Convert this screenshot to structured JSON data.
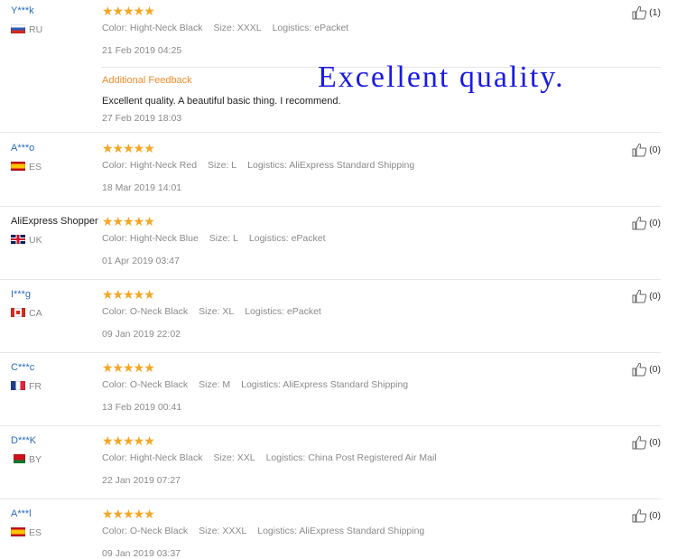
{
  "overlay_caption": "Excellent quality.",
  "reviews": [
    {
      "user": "Y***k",
      "country": "RU",
      "flag": "flag-ru",
      "stars": "★★★★★",
      "color": "Color: Hight-Neck Black",
      "size": "Size: XXXL",
      "logistics": "Logistics: ePacket",
      "date": "21 Feb 2019 04:25",
      "likes": "(1)",
      "additional": {
        "title": "Additional Feedback",
        "text": "Excellent quality. A beautiful basic thing. I recommend.",
        "date": "27 Feb 2019 18:03"
      }
    },
    {
      "user": "A***o",
      "country": "ES",
      "flag": "flag-es",
      "stars": "★★★★★",
      "color": "Color: Hight-Neck Red",
      "size": "Size: L",
      "logistics": "Logistics: AliExpress Standard Shipping",
      "date": "18 Mar 2019 14:01",
      "likes": "(0)"
    },
    {
      "user": "AliExpress Shopper",
      "country": "UK",
      "flag": "flag-uk",
      "stars": "★★★★★",
      "color": "Color: Hight-Neck Blue",
      "size": "Size: L",
      "logistics": "Logistics: ePacket",
      "date": "01 Apr 2019 03:47",
      "likes": "(0)"
    },
    {
      "user": "I***g",
      "country": "CA",
      "flag": "flag-ca",
      "stars": "★★★★★",
      "color": "Color: O-Neck Black",
      "size": "Size: XL",
      "logistics": "Logistics: ePacket",
      "date": "09 Jan 2019 22:02",
      "likes": "(0)"
    },
    {
      "user": "C***c",
      "country": "FR",
      "flag": "flag-fr",
      "stars": "★★★★★",
      "color": "Color: O-Neck Black",
      "size": "Size: M",
      "logistics": "Logistics: AliExpress Standard Shipping",
      "date": "13 Feb 2019 00:41",
      "likes": "(0)"
    },
    {
      "user": "D***K",
      "country": "BY",
      "flag": "flag-by",
      "stars": "★★★★★",
      "color": "Color: Hight-Neck Black",
      "size": "Size: XXL",
      "logistics": "Logistics: China Post Registered Air Mail",
      "date": "22 Jan 2019 07:27",
      "likes": "(0)"
    },
    {
      "user": "A***l",
      "country": "ES",
      "flag": "flag-es",
      "stars": "★★★★★",
      "color": "Color: O-Neck Black",
      "size": "Size: XXXL",
      "logistics": "Logistics: AliExpress Standard Shipping",
      "date": "09 Jan 2019 03:37",
      "likes": "(0)"
    }
  ],
  "rating_value": 5,
  "rating_max": 5,
  "colors": {
    "link": "#2a6cbd",
    "stars": "#f5a623",
    "accent": "#f08c2c",
    "caption": "#1a1ae6"
  }
}
